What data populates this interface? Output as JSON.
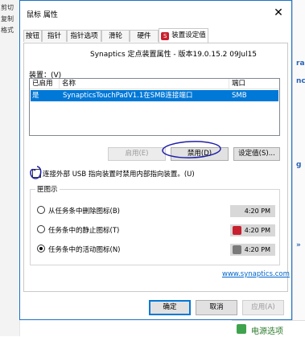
{
  "background": {
    "left_items": [
      "剪切",
      "复制",
      "格式"
    ],
    "right_marks": [
      "ra",
      "nc",
      "g",
      "»"
    ],
    "taskbar_label": "电源选项"
  },
  "dialog": {
    "title": "鼠标 属性",
    "close_glyph": "✕",
    "tabs": [
      {
        "label": "按钮"
      },
      {
        "label": "指针"
      },
      {
        "label": "指针选项"
      },
      {
        "label": "滑轮"
      },
      {
        "label": "硬件"
      },
      {
        "label": "装置设定值",
        "icon": "synaptics-icon"
      }
    ],
    "active_tab": 5,
    "version_line": "Synaptics 定点装置属性 - 版本19.0.15.2 09Jul15",
    "devices_label": "装置：(V)",
    "columns": [
      "已启用",
      "名称",
      "端口"
    ],
    "rows": [
      {
        "enabled": "是",
        "name": "SynapticsTouchPadV1.1在SMB连接端口",
        "port": "SMB"
      }
    ],
    "buttons": {
      "enable": "启用(E)",
      "disable": "禁用(D)",
      "settings": "设定值(S)..."
    },
    "checkbox_label": "连接外部 USB 指向装置时禁用内部指向装置。(U)",
    "tray_group": {
      "label": "匣图示",
      "options": [
        {
          "label": "从任务条中删除图标(B)",
          "selected": false,
          "preview_time": "4:20 PM",
          "icon": "none"
        },
        {
          "label": "任务条中的静止图标(T)",
          "selected": false,
          "preview_time": "4:20 PM",
          "icon": "synaptics-icon"
        },
        {
          "label": "任务条中的活动图标(N)",
          "selected": true,
          "preview_time": "4:20 PM",
          "icon": "touchpad-icon"
        }
      ]
    },
    "link": "www.synaptics.com",
    "footer": {
      "ok": "确定",
      "cancel": "取消",
      "apply": "应用(A)"
    }
  },
  "colors": {
    "accent": "#0078d7",
    "selection": "#0078d7",
    "synaptics_red": "#c8202e",
    "annotation_ink": "#1f1fa8"
  }
}
